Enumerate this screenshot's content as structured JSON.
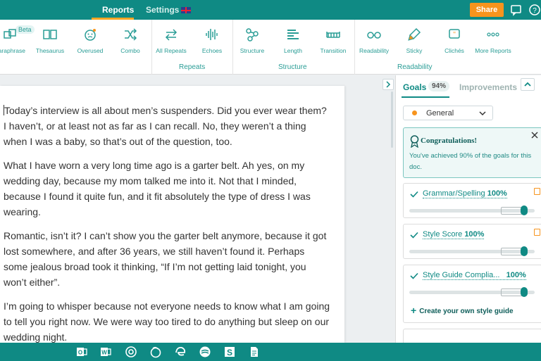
{
  "topbar": {
    "tabs": [
      "Reports",
      "Settings"
    ],
    "share_label": "Share"
  },
  "toolbar": {
    "tools": [
      {
        "label": "Paraphrase",
        "icon": "paraphrase-icon"
      },
      {
        "label": "Thesaurus",
        "icon": "book-icon"
      },
      {
        "label": "Overused",
        "icon": "face-icon"
      },
      {
        "label": "Combo",
        "icon": "shuffle-icon"
      },
      {
        "label": "All Repeats",
        "icon": "repeat-icon"
      },
      {
        "label": "Echoes",
        "icon": "waveform-icon"
      },
      {
        "label": "Structure",
        "icon": "molecule-icon"
      },
      {
        "label": "Length",
        "icon": "length-icon"
      },
      {
        "label": "Transition",
        "icon": "bridge-icon"
      },
      {
        "label": "Readability",
        "icon": "glasses-icon"
      },
      {
        "label": "Sticky",
        "icon": "brush-icon"
      },
      {
        "label": "Clichés",
        "icon": "quote-icon"
      },
      {
        "label": "More Reports",
        "icon": "more-icon"
      }
    ],
    "beta_label": "Beta",
    "groups": [
      "Repeats",
      "Structure",
      "Readability"
    ]
  },
  "document": {
    "paragraphs": [
      "Today’s interview is all about men’s suspenders. Did you ever wear them? I haven’t, or at least not as far as I can recall. No, they weren’t a thing when I was a baby, so that’s out of the question, too.",
      "What I have worn a very long time ago is a garter belt. Ah yes, on my wedding day, because my mom talked me into it. Not that I minded, because I found it quite fun, and it fit absolutely the type of dress I was wearing.",
      "Romantic, isn’t it? I can’t show you the garter belt anymore, because it got lost somewhere, and after 36 years, we still haven’t found it. Perhaps some jealous broad took it thinking, “If I’m not getting laid tonight, you won’t either”.",
      "I’m going to whisper because not everyone needs to know what I am going to tell you right now. We were way too tired to do anything but sleep on our wedding night."
    ]
  },
  "sidebar": {
    "tab_goals": "Goals",
    "goals_pct": "94%",
    "tab_improvements": "Improvements",
    "goal_selector": "General",
    "congrats_title": "Congratulations!",
    "congrats_body": "You've achieved 90% of the goals for this doc.",
    "goals": [
      {
        "name": "Grammar/Spelling",
        "pct": "100%",
        "level": 1.0
      },
      {
        "name": "Style Score",
        "pct": "100%",
        "level": 1.0
      },
      {
        "name": "Style Guide Complia...",
        "pct": "100%",
        "level": 1.0
      }
    ],
    "create_guide_label": "Create your own style guide"
  },
  "colors": {
    "brand": "#0f8a84",
    "accent": "#f7941d"
  },
  "taskbar": {
    "icons": [
      "outlook-icon",
      "word-icon",
      "chrome-icon",
      "firefox-icon",
      "edge-icon",
      "grammar-icon",
      "scrivener-icon",
      "document-icon"
    ]
  }
}
